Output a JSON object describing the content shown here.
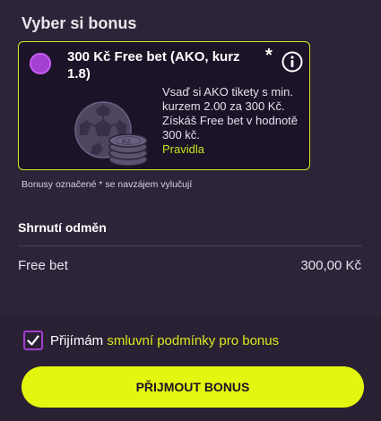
{
  "header": {
    "title": "Vyber si bonus"
  },
  "bonus": {
    "title": "300 Kč Free bet (AKO, kurz 1.8)",
    "asterisk": "*",
    "description": "Vsaď si AKO tikety s min. kurzem 2.00 za 300 Kč. Získáš Free bet v hodnotě 300 kč.",
    "rules_label": "Pravidla",
    "selected": true,
    "icon": "football-coins-icon"
  },
  "note": "Bonusy označené * se navzájem vylučují",
  "summary": {
    "title": "Shrnutí odměn",
    "label": "Free bet",
    "value": "300,00 Kč"
  },
  "terms": {
    "checked": true,
    "prefix": "Přijímám ",
    "link": "smluvní podmínky pro bonus"
  },
  "cta": {
    "label": "PŘIJMOUT BONUS"
  },
  "colors": {
    "background": "#2e2439",
    "accent": "#d4ec1c",
    "purple": "#a33fd1",
    "button": "#e3f60f"
  }
}
